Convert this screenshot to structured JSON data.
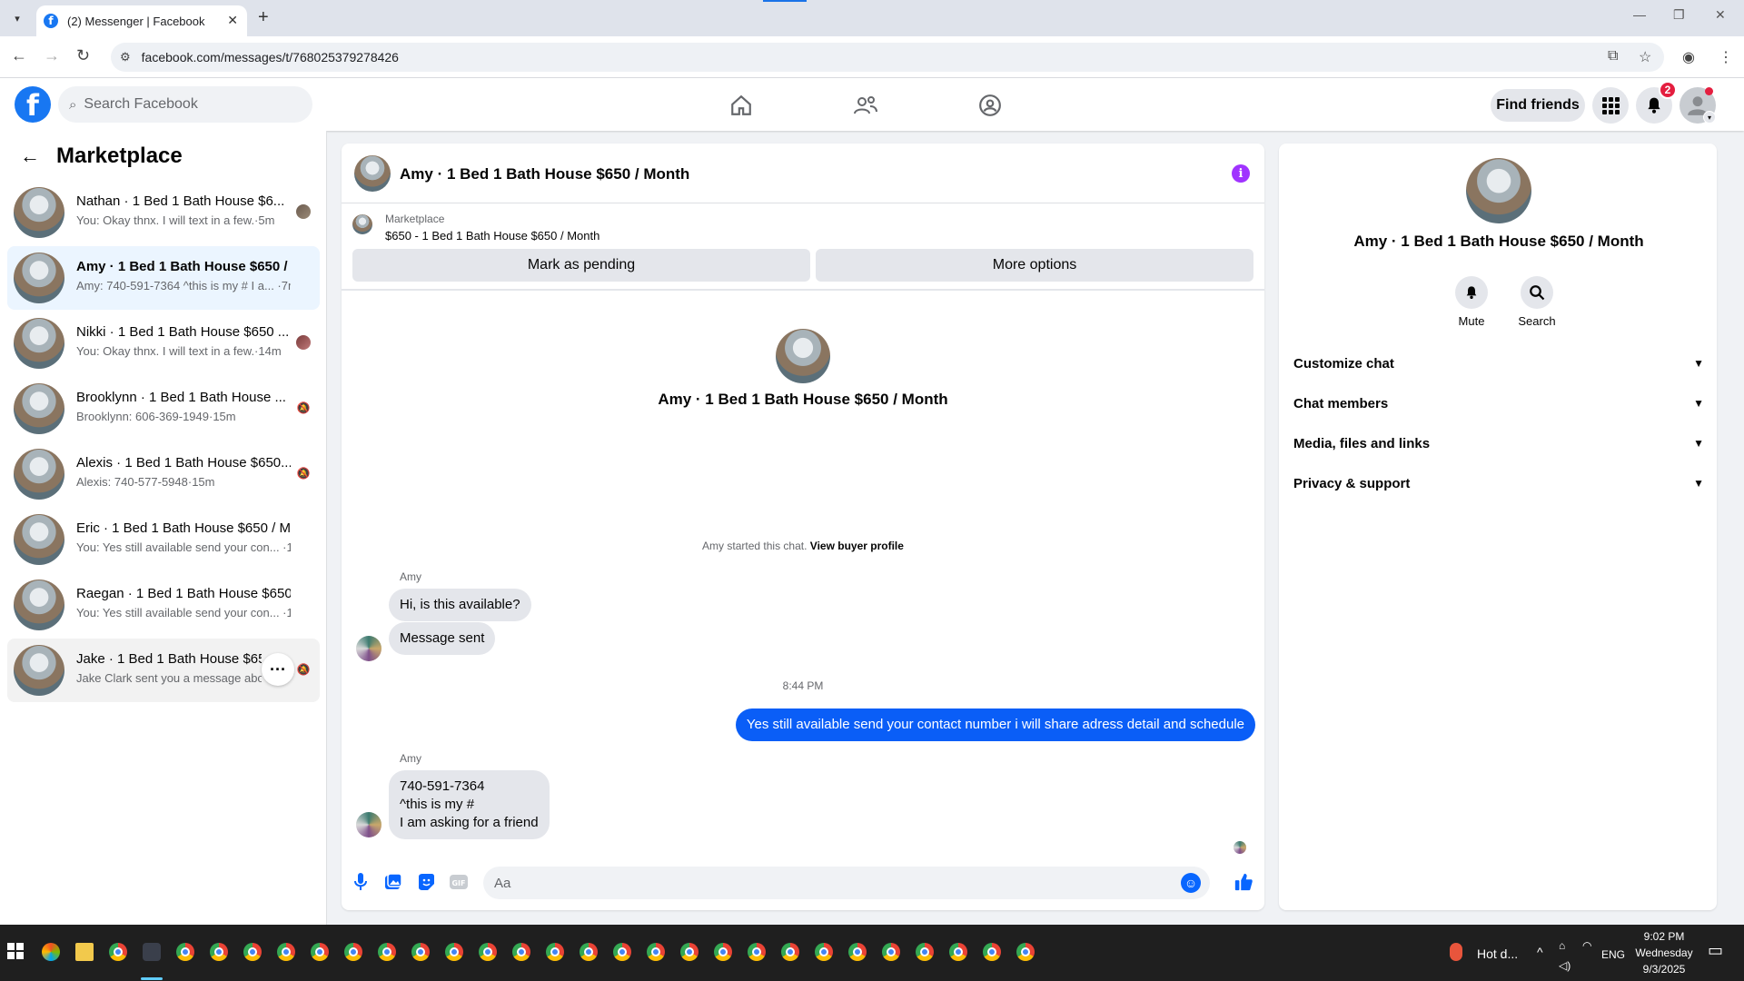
{
  "browser": {
    "tab_title": "(2) Messenger | Facebook",
    "url": "facebook.com/messages/t/768025379278426"
  },
  "header": {
    "search_placeholder": "Search Facebook",
    "find_friends_label": "Find friends",
    "notification_count": "2"
  },
  "sidebar": {
    "title": "Marketplace",
    "conversations": [
      {
        "name": "Nathan · 1 Bed 1 Bath House $6...",
        "snippet": "You: Okay thnx. I will text in a few.·5m"
      },
      {
        "name": "Amy · 1 Bed 1 Bath House $650 / ...",
        "snippet": "Amy: 740-591-7364 ^this is my # I a... ·7m"
      },
      {
        "name": "Nikki · 1 Bed 1 Bath House $650 ...",
        "snippet": "You: Okay thnx. I will text in a few.·14m"
      },
      {
        "name": "Brooklynn · 1 Bed 1 Bath House ...",
        "snippet": "Brooklynn: 606-369-1949·15m"
      },
      {
        "name": "Alexis · 1 Bed 1 Bath House $650...",
        "snippet": "Alexis: 740-577-5948·15m"
      },
      {
        "name": "Eric · 1 Bed 1 Bath House $650 / M...",
        "snippet": "You: Yes still available send your con... ·16m"
      },
      {
        "name": "Raegan · 1 Bed 1 Bath House $650 ...",
        "snippet": "You: Yes still available send your con... ·16m"
      },
      {
        "name": "Jake · 1 Bed 1 Bath House $650",
        "snippet": "Jake Clark sent you a message abo..."
      }
    ]
  },
  "chat": {
    "title": "Amy · 1 Bed 1 Bath House $650 / Month",
    "marketplace_label": "Marketplace",
    "listing": "$650 - 1 Bed 1 Bath House $650 / Month",
    "mark_pending": "Mark as pending",
    "more_options": "More options",
    "intro_title": "Amy · 1 Bed 1 Bath House $650 / Month",
    "started_text": "Amy started this chat.",
    "view_buyer": "View buyer profile",
    "sender_1": "Amy",
    "msg_1": "Hi, is this available?",
    "msg_2": "Message sent",
    "timestamp": "8:44 PM",
    "msg_out": "Yes still available send your contact number i will share adress detail and schedule",
    "sender_2": "Amy",
    "msg_3_line1": "740-591-7364",
    "msg_3_line2": "^this is my #",
    "msg_3_line3": "I am asking for a friend",
    "composer_placeholder": "Aa"
  },
  "info_panel": {
    "title": "Amy · 1 Bed 1 Bath House $650 / Month",
    "mute_label": "Mute",
    "search_label": "Search",
    "rows": [
      "Customize chat",
      "Chat members",
      "Media, files and links",
      "Privacy & support"
    ]
  },
  "taskbar": {
    "weather": "Hot d...",
    "lang": "ENG",
    "time": "9:02 PM",
    "day": "Wednesday",
    "date": "9/3/2025"
  },
  "colors": {
    "fb_blue": "#1877f2",
    "messenger_blue": "#0a5ef7",
    "info_purple": "#a033ff",
    "badge_red": "#e41e3f"
  }
}
